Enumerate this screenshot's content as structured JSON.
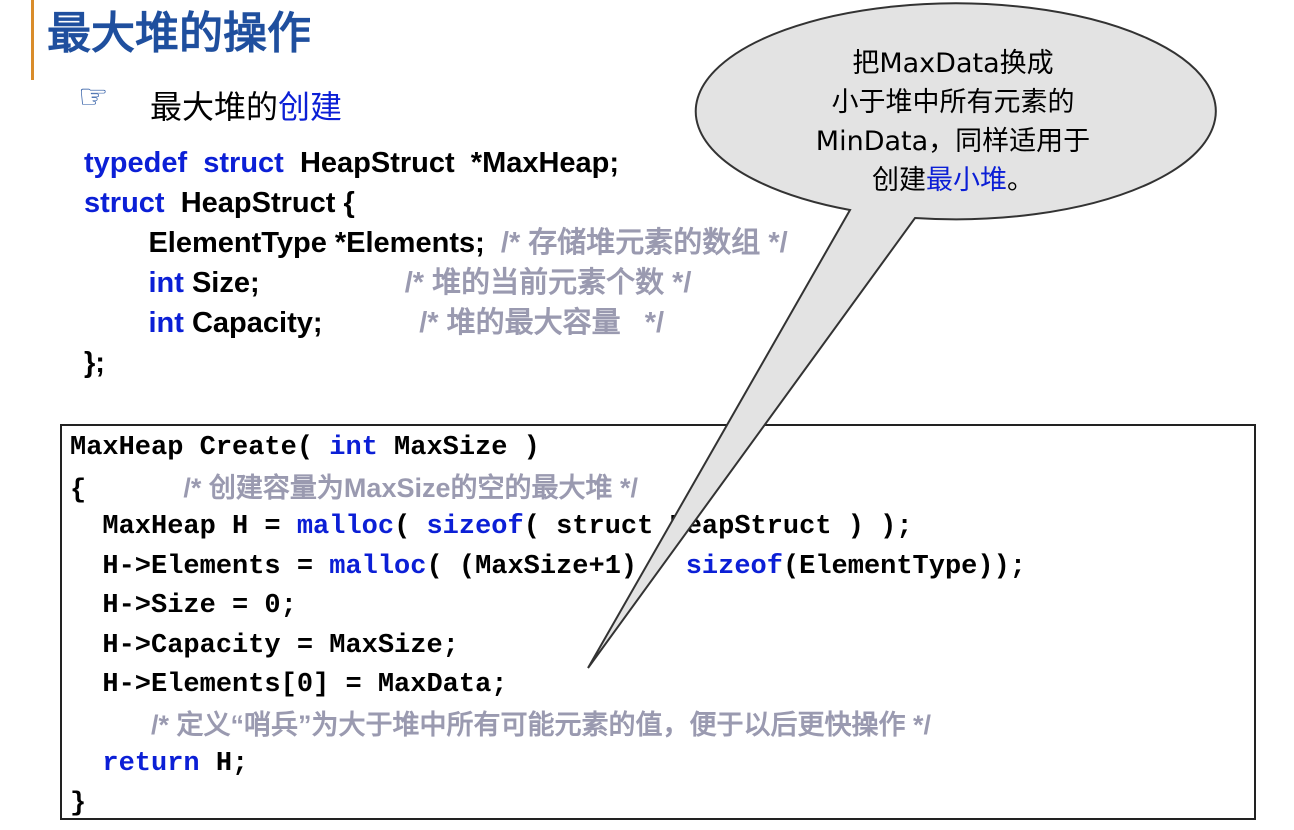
{
  "slide": {
    "title": "最大堆的操作",
    "bullet_prefix": "最大堆的",
    "bullet_highlight": "创建"
  },
  "struct_code": {
    "l1_kw1": "typedef",
    "l1_kw2": "struct",
    "l1_rest": "HeapStruct  *MaxHeap;",
    "l2_kw": "struct",
    "l2_rest": "HeapStruct {",
    "l3_code": "ElementType *Elements;",
    "l3_comment": "/* 存储堆元素的数组 */",
    "l4_kw": "int",
    "l4_code": "Size;",
    "l4_comment": "/* 堆的当前元素个数 */",
    "l5_kw": "int",
    "l5_code": "Capacity;",
    "l5_comment": "/* 堆的最大容量   */",
    "l6_code": "};"
  },
  "create_code": {
    "l1_a": "MaxHeap Create( ",
    "l1_kw": "int",
    "l1_b": " MaxSize )",
    "l2_brace": "{",
    "l2_comment_a": "/* 创建容量为MaxSize的空的",
    "l2_comment_hl": "最大堆",
    "l2_comment_b": " */",
    "l3_a": "MaxHeap H = ",
    "l3_kw1": "malloc",
    "l3_b": "( ",
    "l3_kw2": "sizeof",
    "l3_c": "( struct HeapStruct ) );",
    "l4_a": "H->Elements = ",
    "l4_kw1": "malloc",
    "l4_b": "( (MaxSize+1) * ",
    "l4_kw2": "sizeof",
    "l4_c": "(ElementType));",
    "l5": "H->Size = 0;",
    "l6": "H->Capacity = MaxSize;",
    "l7": "H->Elements[0] = MaxData;",
    "l8_comment": "/* 定义“哨兵”为大于堆中所有可能元素的值，便于以后更快操作 */",
    "l9_kw": "return",
    "l9_rest": " H;",
    "l10_brace": "}"
  },
  "callout": {
    "line1": "把MaxData换成",
    "line2": "小于堆中所有元素的",
    "line3": "MinData，同样适用于",
    "line4_a": "创建",
    "line4_hl": "最小堆",
    "line4_b": "。"
  },
  "colors": {
    "title": "#1f4f9e",
    "keyword": "#0b1fd6",
    "comment": "#9a9ab0",
    "accent_bar": "#d98c2a",
    "callout_fill": "#e3e3e3"
  },
  "icons": {
    "bullet": "pointing-hand-icon"
  }
}
